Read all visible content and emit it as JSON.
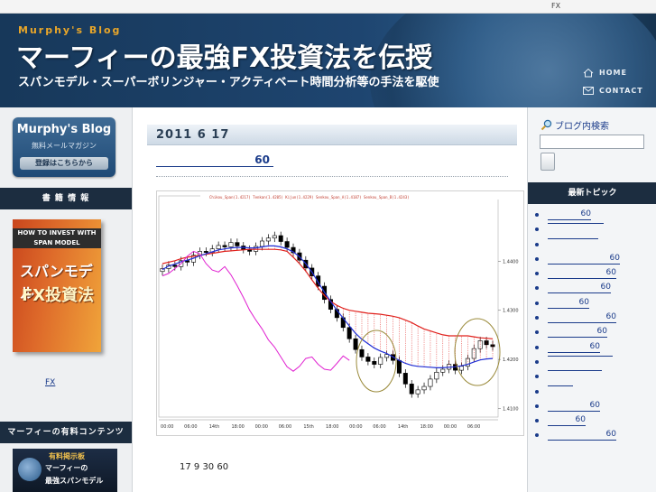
{
  "topbar": {
    "fx_label": "FX"
  },
  "header": {
    "blog_name": "Murphy's Blog",
    "title": "マーフィーの最強FX投資法を伝授",
    "subtitle": "スパンモデル・スーパーボリンジャー・アクティベート時間分析等の手法を駆使",
    "nav": [
      {
        "label": "HOME",
        "icon": "home-icon"
      },
      {
        "label": "CONTACT",
        "icon": "mail-icon"
      }
    ]
  },
  "left_sidebar": {
    "mail_banner": {
      "title": "Murphy's Blog",
      "subtitle": "無料メールマガジン",
      "button": "登録はこちらから"
    },
    "books_heading": "書 籍 情 報",
    "book": {
      "band": "HOW TO INVEST WITH SPAN MODEL",
      "title_main": "スパンモデル",
      "title_fx": "FX投資法"
    },
    "book_link": "FX",
    "paid_heading": "マーフィーの有料コンテンツ",
    "paid_banner": {
      "line1": "有料掲示板",
      "line2": "マーフィーの",
      "line3": "最強スパンモデル"
    }
  },
  "post": {
    "date": "2011  6  17",
    "title": "60",
    "body": "17  9 30          60"
  },
  "right_sidebar": {
    "search_label": "ブログ内検索",
    "topics_heading": "最新トピック",
    "topics": [
      "60",
      "",
      "",
      "60",
      "60",
      "60",
      "60",
      "60",
      "60",
      "60",
      "",
      "",
      "",
      "60",
      "60",
      "60"
    ]
  },
  "chart_data": {
    "type": "line",
    "series_colors": {
      "candles": "#000000",
      "blue_line": "#1f2ed6",
      "red_line": "#e0201c",
      "magenta_line": "#e020d0",
      "band_fill": "#e0201c",
      "circles": "#9a8a3a"
    },
    "y_ticks": [
      "1.4400",
      "1.4300",
      "1.4200",
      "1.4100"
    ],
    "x_ticks": [
      "00:00",
      "06:00",
      "14th",
      "18:00",
      "00:00",
      "06:00",
      "15th",
      "18:00",
      "00:00",
      "06:00",
      "14th",
      "18:00",
      "00:00",
      "06:00"
    ],
    "ylim": [
      1.409,
      1.452
    ],
    "close": [
      1.4385,
      1.4392,
      1.4389,
      1.4401,
      1.4398,
      1.4412,
      1.442,
      1.4418,
      1.4425,
      1.4432,
      1.4429,
      1.4438,
      1.4431,
      1.4424,
      1.442,
      1.443,
      1.4441,
      1.4447,
      1.4452,
      1.444,
      1.4428,
      1.4417,
      1.4402,
      1.4386,
      1.437,
      1.4349,
      1.4322,
      1.4302,
      1.4285,
      1.4265,
      1.4242,
      1.422,
      1.4205,
      1.4196,
      1.419,
      1.4204,
      1.421,
      1.4198,
      1.4172,
      1.415,
      1.413,
      1.4138,
      1.4145,
      1.416,
      1.4174,
      1.418,
      1.419,
      1.4178,
      1.4186,
      1.4202,
      1.4222,
      1.4238,
      1.423,
      1.4226
    ],
    "blue": [
      1.4383,
      1.439,
      1.4394,
      1.4399,
      1.4402,
      1.4406,
      1.4411,
      1.4415,
      1.4419,
      1.4423,
      1.4425,
      1.4427,
      1.4428,
      1.4428,
      1.4427,
      1.4427,
      1.4429,
      1.4431,
      1.4431,
      1.4429,
      1.4425,
      1.4419,
      1.4409,
      1.4395,
      1.4378,
      1.4357,
      1.4337,
      1.4318,
      1.43,
      1.4284,
      1.4268,
      1.4253,
      1.4241,
      1.4232,
      1.4223,
      1.4217,
      1.4212,
      1.4205,
      1.4198,
      1.4192,
      1.4188,
      1.4186,
      1.4185,
      1.4184,
      1.4183,
      1.4183,
      1.4184,
      1.4185,
      1.4187,
      1.419,
      1.4195,
      1.4199,
      1.4201,
      1.4202
    ],
    "red": [
      1.4395,
      1.4398,
      1.4401,
      1.4405,
      1.4408,
      1.441,
      1.4412,
      1.4414,
      1.4416,
      1.4418,
      1.442,
      1.4421,
      1.4422,
      1.4423,
      1.4424,
      1.4424,
      1.4424,
      1.4424,
      1.4424,
      1.4423,
      1.442,
      1.4408,
      1.4395,
      1.438,
      1.4362,
      1.4345,
      1.433,
      1.4318,
      1.431,
      1.4304,
      1.43,
      1.4298,
      1.4296,
      1.4294,
      1.4293,
      1.4292,
      1.429,
      1.4288,
      1.4285,
      1.428,
      1.4275,
      1.4268,
      1.4262,
      1.4258,
      1.4254,
      1.425,
      1.4248,
      1.4248,
      1.4248,
      1.4248,
      1.4246,
      1.4244,
      1.4243,
      1.4242
    ],
    "magenta": [
      1.437,
      1.4375,
      1.4385,
      1.4395,
      1.441,
      1.442,
      1.4415,
      1.4395,
      1.4382,
      1.4378,
      1.4389,
      1.4372,
      1.435,
      1.4326,
      1.43,
      1.428,
      1.4262,
      1.424,
      1.4225,
      1.4205,
      1.4185,
      1.4176,
      1.4186,
      1.4202,
      1.4205,
      1.419,
      1.418,
      1.4178,
      1.4192,
      1.4207,
      1.4198,
      null,
      null,
      null,
      null,
      null,
      null,
      null,
      null,
      null,
      null,
      null,
      null,
      null,
      null,
      null,
      null,
      null,
      null,
      null,
      null,
      null,
      null,
      null
    ]
  }
}
